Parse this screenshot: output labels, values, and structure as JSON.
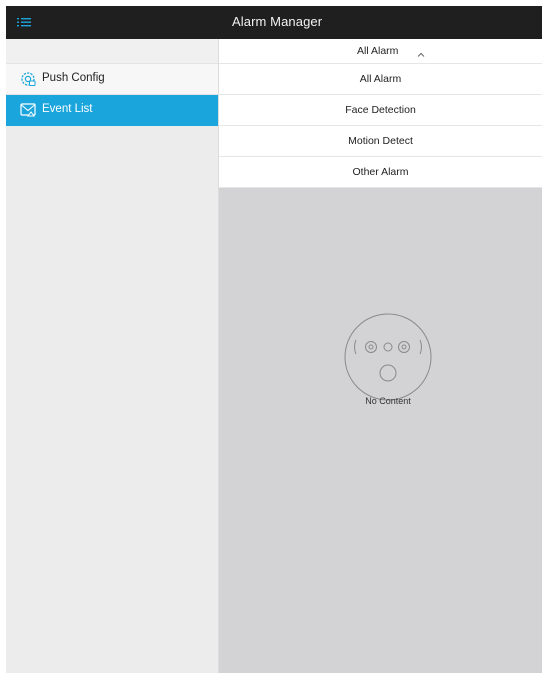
{
  "header": {
    "title": "Alarm Manager",
    "menu_icon": "list-menu-icon"
  },
  "sidebar": {
    "items": [
      {
        "label": "Push Config",
        "icon": "gear-config-icon",
        "active": false
      },
      {
        "label": "Event List",
        "icon": "event-list-icon",
        "active": true
      }
    ]
  },
  "filter": {
    "selected": "All Alarm",
    "options": [
      "All Alarm",
      "Face Detection",
      "Motion Detect",
      "Other Alarm"
    ]
  },
  "empty_state": {
    "text": "No Content",
    "icon": "empty-box-icon"
  },
  "colors": {
    "accent": "#1aa6dd",
    "topbar": "#1f1f1f",
    "panel": "#d3d3d5"
  }
}
